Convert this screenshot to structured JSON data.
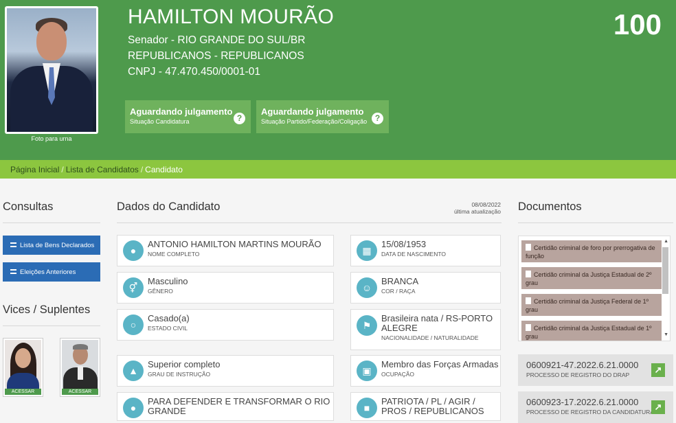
{
  "header": {
    "name": "HAMILTON MOURÃO",
    "office": "Senador - RIO GRANDE DO SUL/BR",
    "party": "REPUBLICANOS - REPUBLICANOS",
    "cnpj": "CNPJ - 47.470.450/0001-01",
    "number": "100",
    "photo_caption": "Foto para urna",
    "status": [
      {
        "title": "Aguardando julgamento",
        "subtitle": "Situação Candidatura"
      },
      {
        "title": "Aguardando julgamento",
        "subtitle": "Situação Partido/Federação/Coligação"
      }
    ],
    "help_glyph": "?"
  },
  "breadcrumb": [
    "Página Inicial",
    "Lista de Candidatos",
    "Candidato"
  ],
  "breadcrumb_sep": "/",
  "sidebar": {
    "consultas_title": "Consultas",
    "buttons": [
      "Lista de Bens Declarados",
      "Eleições Anteriores"
    ],
    "vices_title": "Vices / Suplentes",
    "vice_button": "ACESSAR"
  },
  "dados": {
    "title": "Dados do Candidato",
    "update_date": "08/08/2022",
    "update_label": "última atualização",
    "fields": [
      {
        "value": "ANTONIO HAMILTON MARTINS MOURÃO",
        "label": "NOME COMPLETO",
        "icon": "user-icon"
      },
      {
        "value": "15/08/1953",
        "label": "DATA DE NASCIMENTO",
        "icon": "calendar-icon"
      },
      {
        "value": "Masculino",
        "label": "GÊNERO",
        "icon": "gender-icon"
      },
      {
        "value": "BRANCA",
        "label": "COR / RAÇA",
        "icon": "person-icon"
      },
      {
        "value": "Casado(a)",
        "label": "ESTADO CIVIL",
        "icon": "ring-icon"
      },
      {
        "value": "Brasileira nata / RS-PORTO ALEGRE",
        "label": "NACIONALIDADE / NATURALIDADE",
        "icon": "map-icon"
      },
      {
        "value": "Superior completo",
        "label": "GRAU DE INSTRUÇÃO",
        "icon": "graduation-cap-icon"
      },
      {
        "value": "Membro das Forças Armadas",
        "label": "OCUPAÇÃO",
        "icon": "bank-icon"
      },
      {
        "value": "PARA DEFENDER E TRANSFORMAR O RIO GRANDE",
        "label": "",
        "icon": "group-icon"
      },
      {
        "value": "PATRIOTA / PL / AGIR / PROS / REPUBLICANOS",
        "label": "",
        "icon": "folder-icon"
      }
    ]
  },
  "documentos": {
    "title": "Documentos",
    "items": [
      "Certidão criminal de foro por prerrogativa de função",
      "Certidão criminal da Justiça Estadual de 2º grau",
      "Certidão criminal da Justiça Federal de 1º grau",
      "Certidão criminal da Justiça Estadual de 1º grau"
    ],
    "processes": [
      {
        "number": "0600921-47.2022.6.21.0000",
        "label": "PROCESSO DE REGISTRO DO DRAP"
      },
      {
        "number": "0600923-17.2022.6.21.0000",
        "label": "PROCESSO DE REGISTRO DA CANDIDATURA"
      }
    ]
  },
  "colors": {
    "header_green": "#4e9a4c",
    "breadcrumb_green": "#8cc63f",
    "button_blue": "#2b6cb5",
    "icon_teal": "#5ab4c6",
    "doc_brown": "#b8a49e"
  }
}
